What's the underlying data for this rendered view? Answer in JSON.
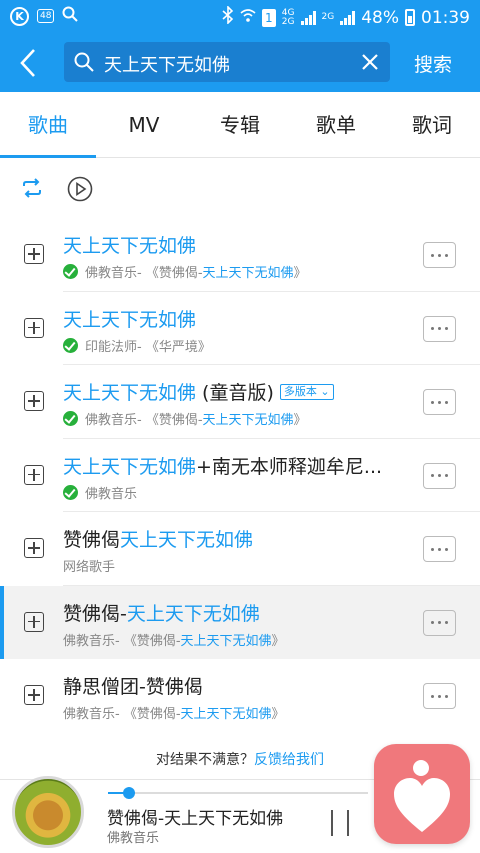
{
  "status_bar": {
    "k_badge": "K",
    "count_badge": "48",
    "network_4g": "4G",
    "network_2g": "2G",
    "network_2g_b": "2G",
    "sim": "1",
    "battery": "48%",
    "time": "01:39"
  },
  "header": {
    "search_value": "天上天下无如佛",
    "search_button": "搜索"
  },
  "tabs": [
    "歌曲",
    "MV",
    "专辑",
    "歌单",
    "歌词"
  ],
  "songs": [
    {
      "title_hl": "天上天下无如佛",
      "title_rest": "",
      "artist": "佛教音乐",
      "album_pre": " - 《赞佛偈-",
      "album_hl": "天上天下无如佛",
      "album_post": "》"
    },
    {
      "title_hl": "天上天下无如佛",
      "title_rest": "",
      "artist": "印能法师",
      "album_pre": " - 《华严境》",
      "album_hl": "",
      "album_post": ""
    },
    {
      "title_hl": "天上天下无如佛",
      "title_rest": " (童音版)",
      "badge": "多版本",
      "artist": "佛教音乐",
      "album_pre": " - 《赞佛偈-",
      "album_hl": "天上天下无如佛",
      "album_post": "》"
    },
    {
      "title_hl": "天上天下无如佛",
      "title_rest": "+南无本师释迦牟尼...",
      "artist": "佛教音乐",
      "album_pre": "",
      "album_hl": "",
      "album_post": ""
    },
    {
      "title_pre": "赞佛偈",
      "title_hl": "天上天下无如佛",
      "artist": "网络歌手"
    },
    {
      "title_pre": "赞佛偈-",
      "title_hl": "天上天下无如佛",
      "artist": "佛教音乐",
      "album_pre": " - 《赞佛偈-",
      "album_hl": "天上天下无如佛",
      "album_post": "》"
    },
    {
      "title_pre": "静思僧团-赞佛偈",
      "title_hl": "",
      "artist": "佛教音乐",
      "album_pre": " - 《赞佛偈-",
      "album_hl": "天上天下无如佛",
      "album_post": "》"
    }
  ],
  "feedback": {
    "text": "对结果不满意？",
    "link": "反馈给我们"
  },
  "now_playing": {
    "title": "赞佛偈-天上天下无如佛",
    "artist": "佛教音乐",
    "progress": 0.08
  },
  "colors": {
    "accent": "#1c9bf0",
    "check": "#27b03b",
    "float_app": "#f0787c"
  }
}
